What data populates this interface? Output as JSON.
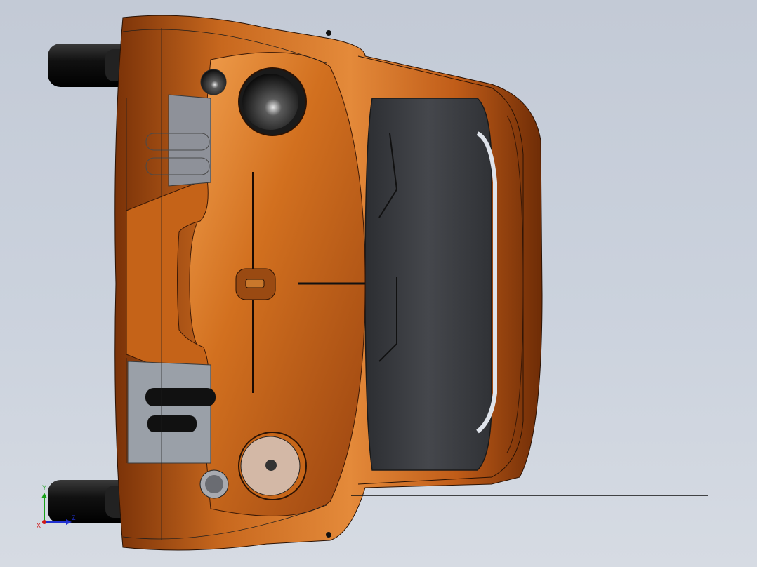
{
  "view": {
    "background_top": "#c3cad6",
    "background_bottom": "#d6dbe3"
  },
  "model": {
    "body_color": "#c2611c",
    "body_highlight": "#f0a055",
    "body_shadow": "#6a2a06",
    "glass_color": "#3c3e42",
    "tire_color": "#151515",
    "interior_color": "#8b8f97"
  },
  "triad": {
    "x_label": "X",
    "y_label": "Y",
    "z_label": "Z",
    "x_color": "#d01818",
    "y_color": "#18a018",
    "z_color": "#2030d0"
  }
}
